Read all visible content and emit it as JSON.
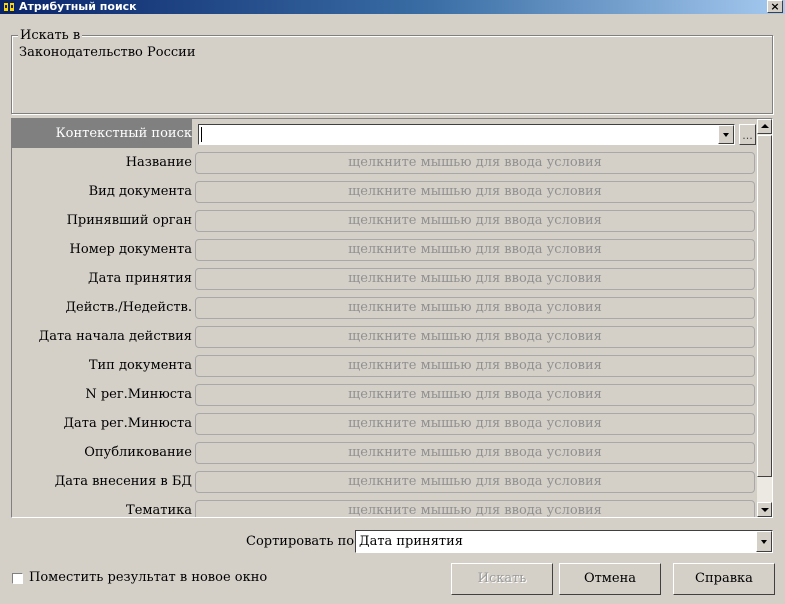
{
  "window": {
    "title": "Атрибутный поиск",
    "close_glyph": "×"
  },
  "search_in": {
    "legend": "Искать в",
    "value": "Законодательство России"
  },
  "context_search": {
    "label": "Контекстный поиск",
    "value": "",
    "ellipsis": "..."
  },
  "attributes": {
    "placeholder": "щелкните мышью для ввода условия",
    "rows": [
      "Название",
      "Вид документа",
      "Принявший орган",
      "Номер документа",
      "Дата принятия",
      "Действ./Недейств.",
      "Дата начала действия",
      "Тип документа",
      "N рег.Минюста",
      "Дата рег.Минюста",
      "Опубликование",
      "Дата внесения в БД",
      "Тематика"
    ]
  },
  "sort": {
    "label": "Сортировать по:",
    "value": "Дата принятия"
  },
  "new_window_checkbox": {
    "label": "Поместить результат в новое окно",
    "checked": false
  },
  "buttons": {
    "search": "Искать",
    "cancel": "Отмена",
    "help": "Справка"
  },
  "icons": {
    "app": "search-app-icon",
    "close": "close-icon"
  }
}
